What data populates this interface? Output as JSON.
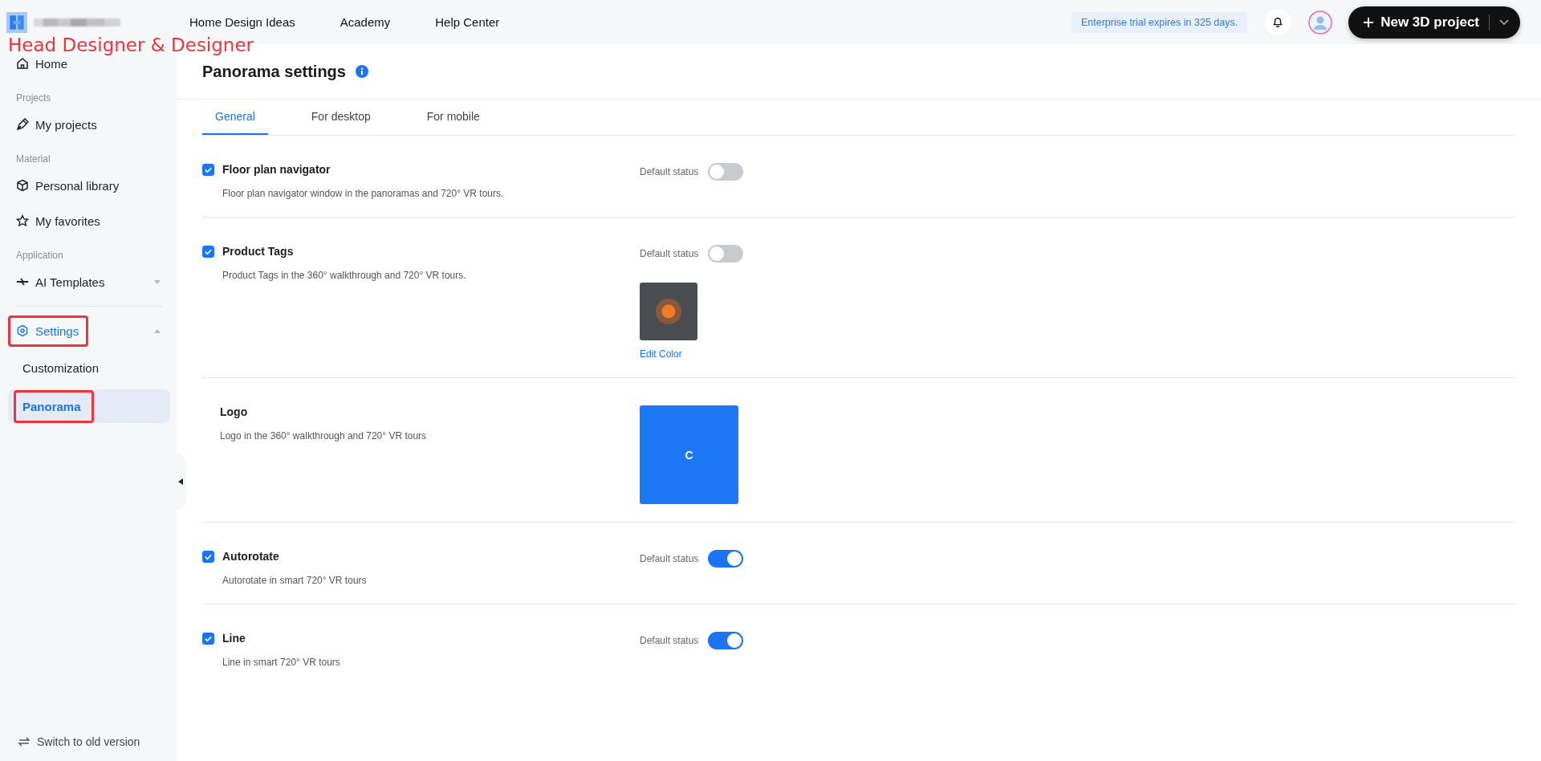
{
  "header": {
    "nav": [
      "Home Design Ideas",
      "Academy",
      "Help Center"
    ],
    "trial_badge": "Enterprise trial expires in 325 days.",
    "new_project_button": "New 3D project"
  },
  "annotation": "Head Designer & Designer",
  "sidebar": {
    "items": [
      {
        "kind": "link",
        "label": "Home",
        "selected": false,
        "highlighted": false
      },
      {
        "kind": "heading",
        "label": "Projects"
      },
      {
        "kind": "link",
        "label": "My projects",
        "selected": false,
        "highlighted": false
      },
      {
        "kind": "heading",
        "label": "Material"
      },
      {
        "kind": "link",
        "label": "Personal library",
        "selected": false,
        "highlighted": false
      },
      {
        "kind": "link",
        "label": "My favorites",
        "selected": false,
        "highlighted": false
      },
      {
        "kind": "heading",
        "label": "Application"
      },
      {
        "kind": "group",
        "label": "AI Templates",
        "expanded": false,
        "selected": false,
        "highlighted": false
      },
      {
        "kind": "divider"
      },
      {
        "kind": "group",
        "label": "Settings",
        "expanded": true,
        "selected": true,
        "highlighted": true
      },
      {
        "kind": "subitem",
        "label": "Customization",
        "selected": false,
        "highlighted": false
      },
      {
        "kind": "subitem",
        "label": "Panorama",
        "selected": true,
        "highlighted": true
      }
    ],
    "footer_link": "Switch to old version"
  },
  "page": {
    "title": "Panorama settings",
    "tabs": [
      {
        "label": "General",
        "selected": true
      },
      {
        "label": "For desktop",
        "selected": false
      },
      {
        "label": "For mobile",
        "selected": false
      }
    ],
    "settings": [
      {
        "kind": "toggle",
        "title": "Floor plan navigator",
        "description": "Floor plan navigator window in the panoramas and 720° VR tours.",
        "checked": true,
        "status_label": "Default status",
        "on": false
      },
      {
        "kind": "tag",
        "title": "Product Tags",
        "description": "Product Tags in the 360° walkthrough and 720° VR tours.",
        "checked": true,
        "status_label": "Default status",
        "on": false,
        "link": "Edit Color"
      },
      {
        "kind": "logo",
        "title": "Logo",
        "description": "Logo in the 360° walkthrough and 720° VR tours",
        "logo_text": "C"
      },
      {
        "kind": "toggle",
        "title": "Autorotate",
        "description": "Autorotate in smart 720° VR tours",
        "checked": true,
        "status_label": "Default status",
        "on": true
      },
      {
        "kind": "toggle",
        "title": "Line",
        "description": "Line in smart 720° VR tours",
        "checked": true,
        "status_label": "Default status",
        "on": true
      }
    ]
  }
}
